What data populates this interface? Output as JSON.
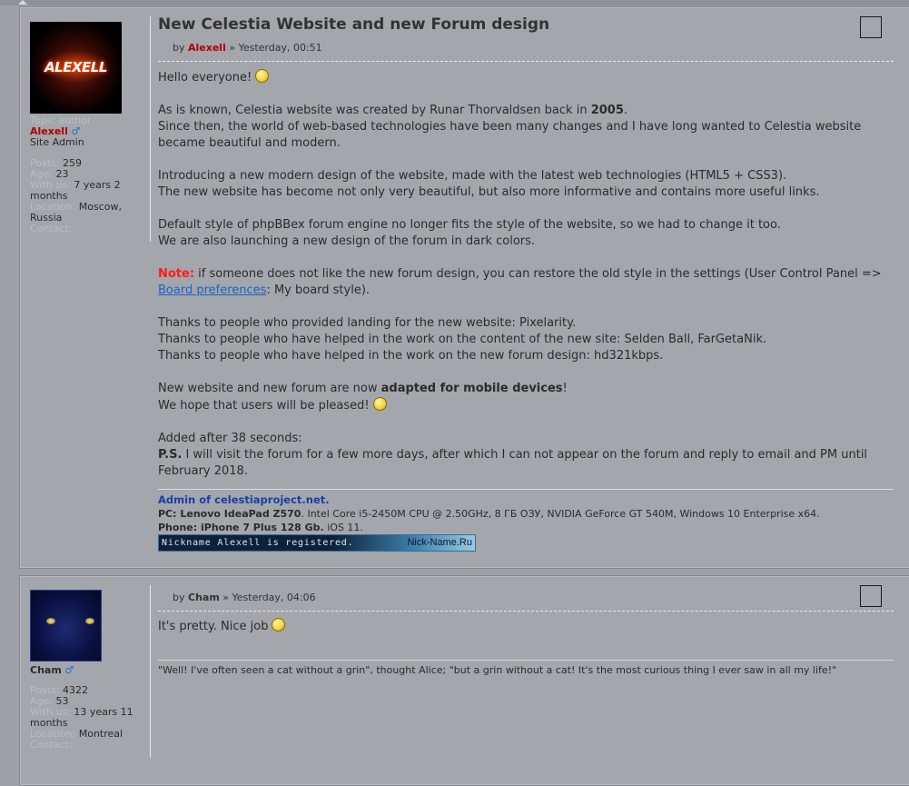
{
  "post1": {
    "title": "New Celestia Website and new Forum design",
    "by_prefix": "by",
    "author": "Alexell",
    "date_sep": "»",
    "date": "Yesterday, 00:51",
    "profile": {
      "avatar_text": "ALEXELL",
      "role_label": "Topic author",
      "name": "Alexell",
      "gender_icon": "♂",
      "rank": "Site Admin",
      "posts_label": "Posts:",
      "posts": "259",
      "age_label": "Age:",
      "age": "23",
      "with_us_label": "With us:",
      "with_us": "7 years 2 months",
      "location_label": "Location:",
      "location": "Moscow, Russia",
      "contact_label": "Contact:"
    },
    "body": {
      "p1": "Hello everyone!",
      "p2a": "As is known, Celestia website was created by Runar Thorvaldsen back in ",
      "p2b": "2005",
      "p2c": ".",
      "p3": "Since then, the world of web-based technologies have been many changes and I have long wanted to Celestia website became beautiful and modern.",
      "p4": "Introducing a new modern design of the website, made with the latest web technologies (HTML5 + CSS3).",
      "p5": "The new website has become not only very beautiful, but also more informative and contains more useful links.",
      "p6": "Default style of phpBBex forum engine no longer fits the style of the website, so we had to change it too.",
      "p7": "We are also launching a new design of the forum in dark colors.",
      "note_label": "Note:",
      "note_text": " if someone does not like the new forum design, you can restore the old style in the settings (User Control Panel => ",
      "note_link": "Board preferences",
      "note_end": ": My board style).",
      "t1": "Thanks to people who provided landing for the new website: Pixelarity.",
      "t2": "Thanks to people who have helped in the work on the content of the new site: Selden Ball, FarGetaNik.",
      "t3": "Thanks to people who have helped in the work on the new forum design: hd321kbps.",
      "m1a": "New website and new forum are now ",
      "m1b": "adapted for mobile devices",
      "m1c": "!",
      "m2": "We hope that users will be pleased!",
      "added": "Added after 38 seconds:",
      "ps_label": "P.S.",
      "ps_text": " I will visit the forum for a few more days, after which I can not appear on the forum and reply to email and PM until February 2018."
    },
    "signature": {
      "title": "Admin of celestiaproject.net.",
      "pc_label": "PC: Lenovo IdeaPad Z570",
      "pc_text": ". Intel Core i5-2450M CPU @ 2.50GHz, 8 ГБ ОЗУ, NVIDIA GeForce GT 540M, Windows 10 Enterprise x64.",
      "phone_label": "Phone: ",
      "phone_model": "iPhone 7 Plus 128 Gb.",
      "phone_text": " iOS 11.",
      "banner_left": "Nickname Alexell is registered.",
      "banner_right": "Nick-Name.Ru"
    }
  },
  "post2": {
    "by_prefix": "by",
    "author": "Cham",
    "date_sep": "»",
    "date": "Yesterday, 04:06",
    "profile": {
      "name": "Cham",
      "gender_icon": "♂",
      "posts_label": "Posts:",
      "posts": "4322",
      "age_label": "Age:",
      "age": "53",
      "with_us_label": "With us:",
      "with_us": "13 years 11 months",
      "location_label": "Location:",
      "location": "Montreal",
      "contact_label": "Contact:"
    },
    "body": "It's pretty. Nice job",
    "signature": "\"Well! I've often seen a cat without a grin\", thought Alice; \"but a grin without a cat! It's the most curious thing I ever saw in all my life!\""
  }
}
